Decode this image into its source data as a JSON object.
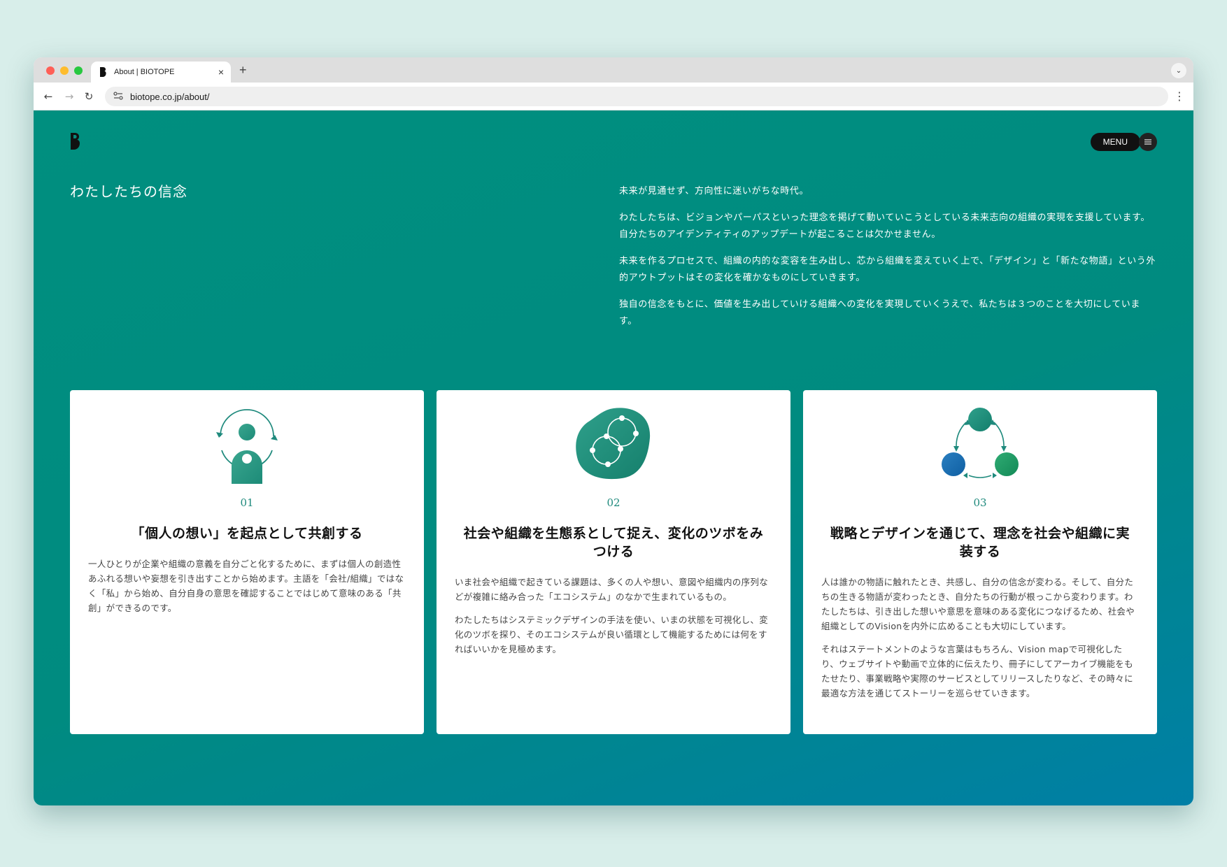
{
  "browser": {
    "tab_title": "About | BIOTOPE",
    "url": "biotope.co.jp/about/"
  },
  "header": {
    "logo_text": "B",
    "menu_label": "MENU"
  },
  "beliefs": {
    "title": "わたしたちの信念",
    "paragraphs": [
      "未来が見通せず、方向性に迷いがちな時代。",
      "わたしたちは、ビジョンやパーパスといった理念を掲げて動いていこうとしている未来志向の組織の実現を支援しています。自分たちのアイデンティティのアップデートが起こることは欠かせません。",
      "未来を作るプロセスで、組織の内的な変容を生み出し、芯から組織を変えていく上で、「デザイン」と「新たな物語」という外的アウトプットはその変化を確かなものにしていきます。",
      "独自の信念をもとに、価値を生み出していける組織への変化を実現していくうえで、私たちは３つのことを大切にしています。"
    ]
  },
  "cards": [
    {
      "number": "01",
      "heading": "「個人の想い」を起点として共創する",
      "paragraphs": [
        "一人ひとりが企業や組織の意義を自分ごと化するために、まずは個人の創造性あふれる想いや妄想を引き出すことから始めます。主語を「会社/組織」ではなく「私」から始め、自分自身の意思を確認することではじめて意味のある「共創」ができるのです。"
      ]
    },
    {
      "number": "02",
      "heading": "社会や組織を生態系として捉え、変化のツボをみつける",
      "paragraphs": [
        "いま社会や組織で起きている課題は、多くの人や想い、意図や組織内の序列などが複雑に絡み合った「エコシステム」のなかで生まれているもの。",
        "わたしたちはシステミックデザインの手法を使い、いまの状態を可視化し、変化のツボを探り、そのエコシステムが良い循環として機能するためには何をすればいいかを見極めます。"
      ]
    },
    {
      "number": "03",
      "heading": "戦略とデザインを通じて、理念を社会や組織に実装する",
      "paragraphs": [
        "人は誰かの物語に触れたとき、共感し、自分の信念が変わる。そして、自分たちの生きる物語が変わったとき、自分たちの行動が根っこから変わります。わたしたちは、引き出した想いや意思を意味のある変化につなげるため、社会や組織としてのVisionを内外に広めることも大切にしています。",
        "それはステートメントのような言葉はもちろん、Vision mapで可視化したり、ウェブサイトや動画で立体的に伝えたり、冊子にしてアーカイブ機能をもたせたり、事業戦略や実際のサービスとしてリリースしたりなど、その時々に最適な方法を通じてストーリーを巡らせていきます。"
      ]
    }
  ],
  "colors": {
    "accent": "#1f8a7d",
    "page_bg_start": "#008f7f",
    "page_bg_end": "#007fa6"
  }
}
